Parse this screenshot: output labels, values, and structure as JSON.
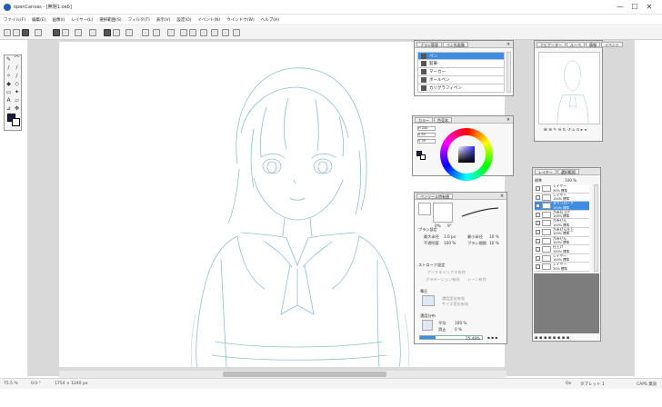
{
  "window": {
    "title": "openCanvas - [無題1.oeb]",
    "controls": [
      "—",
      "☐",
      "✕"
    ]
  },
  "menu": [
    "ファイル(F)",
    "編集(E)",
    "画像(I)",
    "レイヤー(L)",
    "選択範囲(S)",
    "フィルタ(T)",
    "表示(V)",
    "設定(O)",
    "イベント(N)",
    "ウインドウ(W)",
    "ヘルプ(H)"
  ],
  "brush_panel": {
    "tabs": [
      "ブラシ管理",
      "ペン先画像"
    ],
    "items": [
      "ペン",
      "鉛筆",
      "マーカー",
      "ボールペン",
      "カリグラフィペン"
    ],
    "selected_index": 0
  },
  "color_panel": {
    "tabs": [
      "カラー",
      "色見本"
    ],
    "h_label": "H",
    "h_value": "240",
    "s_label": "S",
    "s_value": "50",
    "v_label": "V",
    "v_value": "30",
    "accent": "#1a1f4a"
  },
  "brush_props": {
    "tabs": [
      "ペンツール特有値"
    ],
    "size_min": "0%",
    "size_max": "9°",
    "section_brush": "ブラシ設定",
    "max_size_label": "最大半径",
    "max_size_value": "1.0 px",
    "min_size_label": "最小半径",
    "min_size_value": "10 %",
    "opacity_label": "不透明度",
    "opacity_value": "100 %",
    "interval_label": "ブラシ間隔",
    "interval_value": "10 %",
    "section_stroke": "ストローク設定",
    "opt_antialias": "アンチエイリアス有効",
    "opt_gradation": "グラデーション有効",
    "opt_tone": "トーン有効",
    "section_texture": "筆圧",
    "tex_opt1": "濃度変化有効",
    "tex_opt2": "サイズ変化有効",
    "section_density": "濃度分布",
    "avg_label": "平均",
    "avg_value": "100 %",
    "hit_label": "滑止",
    "hit_value": "0 %",
    "progress_text": "25.49%",
    "progress": 0.2549
  },
  "navigator": {
    "tabs": [
      "ナビゲーター",
      "ルーペ",
      "情報",
      "イベント"
    ],
    "controls": "⊞ ⊕ ✎ ⊖ ↻ ↺ ⌂     ⊙ ▸ ◂"
  },
  "layers_panel": {
    "tabs": [
      "レイヤー",
      "選択範囲"
    ],
    "mode": "標準",
    "opacity": "100 %",
    "layers": [
      {
        "name": "レイヤー",
        "mode": "30% 標準",
        "selected": false
      },
      {
        "name": "レイヤー",
        "mode": "100% 標準",
        "selected": false
      },
      {
        "name": "ダウンロード",
        "mode": "100% 標準",
        "selected": true
      },
      {
        "name": "かみ仕上げ",
        "mode": "100% 標準",
        "selected": false
      },
      {
        "name": "かみせん",
        "mode": "100% 標準",
        "selected": false
      },
      {
        "name": "かみせん仕上",
        "mode": "100% 標準",
        "selected": false
      },
      {
        "name": "かみせん",
        "mode": "100% 標準",
        "selected": false
      },
      {
        "name": "仕上げ",
        "mode": "100% 標準",
        "selected": false
      },
      {
        "name": "レイヤー",
        "mode": "100% 標準",
        "selected": false
      },
      {
        "name": "レイヤー",
        "mode": "30% 標準",
        "selected": false
      }
    ]
  },
  "status": {
    "zoom": "75.5 %",
    "rotation": "0.0 °",
    "size": "1754 × 1240 px",
    "tablet_on": "On",
    "tablet": "タブレット 1",
    "capslock": "CAPS 無効"
  },
  "colors": {
    "selection": "#3f8de0",
    "sketch_line": "#8ebfcc"
  }
}
